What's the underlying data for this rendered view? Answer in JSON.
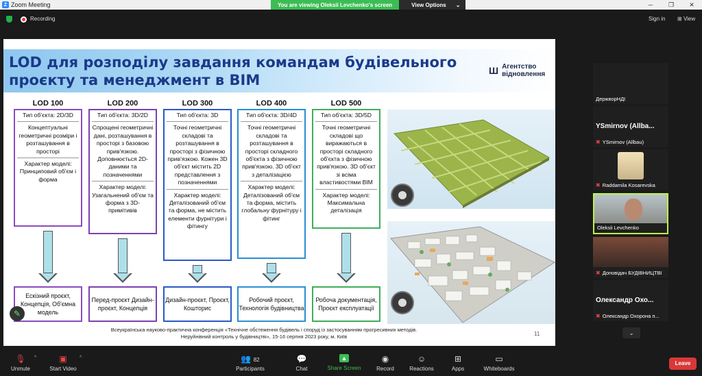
{
  "window": {
    "title": "Zoom Meeting",
    "viewing_banner": "You are viewing Oleksii Levchenko's screen",
    "view_options": "View Options",
    "sign_in": "Sign in",
    "view": "View"
  },
  "topbar": {
    "recording": "Recording"
  },
  "slide": {
    "title_line1": "LOD для розподілу завдання командам будівельного",
    "title_line2": "проєкту та менеджмент в BIM",
    "agency": "Агентство відновлення",
    "columns": [
      {
        "head": "LOD 100",
        "type": "Тип об'єкта: 2D/3D",
        "desc": "Концептуальні геометричні розміри і розташування в просторі",
        "model": "Характер моделі: Принциповий об'єм і форма",
        "bottom": "Ескізний проєкт, Концепція, Об'ємна модель",
        "color": "#8a4bbf"
      },
      {
        "head": "LOD 200",
        "type": "Тип об'єкта: 3D/2D",
        "desc": "Спрощені геометричні дані, розташування в просторі з базовою прив'язкою. Доповнюється 2D-даними та позначеннями",
        "model": "Характер моделі: Узагальнений об'єм та форма з 3D-примітивів",
        "bottom": "Перед-проєкт Дизайн-проєкт, Концепція",
        "color": "#7d3fb0"
      },
      {
        "head": "LOD 300",
        "type": "Тип об'єкта: 3D",
        "desc": "Точні геометричні складові та розташування в просторі з фізичною прив'язкою. Кожен 3D об'єкт містить 2D представлення з позначеннями",
        "model": "Характер моделі: Деталізований об'єм та форма, не містить елементи фурнітури і фітингу",
        "bottom": "Дизайн-проєкт, Проєкт, Кошторис",
        "color": "#2a59c6"
      },
      {
        "head": "LOD 400",
        "type": "Тип об'єкта: 3D/4D",
        "desc": "Точні геометричні складові та розташування в просторі складного об'єкта з фізичною прив'язкою. 3D об'єкт з деталізацією",
        "model": "Характер моделі: Деталізований об'єм та форма, містить глобальну фурнітуру і фітинг",
        "bottom": "Робочий проєкт, Технологія будівництва",
        "color": "#2a8fd0"
      },
      {
        "head": "LOD 500",
        "type": "Тип об'єкта: 3D/5D",
        "desc": "Точні геометричні складові що виражаються в просторі складного об'єкта з фізичною прив'язкою. 3D об'єкт зі всіма властивостями BIM",
        "model": "Характер моделі: Максимальна деталізація",
        "bottom": "Робоча документація, Проєкт експлуатації",
        "color": "#3fae5a"
      }
    ],
    "footer_line1": "Всеукраїнська науково-практична конференція «Технічне обстеження будівель і споруд із застосуванням прогресивних методів.",
    "footer_line2": "Неруйнівний контроль у будівництві», 15-16 серпня 2023 року, м. Київ",
    "page_number": "11"
  },
  "participants": [
    {
      "big": "",
      "label": "ДержворНДІ",
      "muted": false
    },
    {
      "big": "YSmirnov (Allba...",
      "label": "YSmirnov (Allbau)",
      "muted": true
    },
    {
      "big": "",
      "label": "Raddamila Kosarevska",
      "muted": true
    },
    {
      "big": "",
      "label": "Oleksii Levchenko",
      "muted": false,
      "active": true
    },
    {
      "big": "",
      "label": "Доповідач БУДІВНИЦТВІ",
      "muted": true
    },
    {
      "big": "Олександр Охо...",
      "label": "Олександр Охорона п...",
      "muted": true
    }
  ],
  "toolbar": {
    "unmute": "Unmute",
    "start_video": "Start Video",
    "participants": "Participants",
    "participants_count": "82",
    "chat": "Chat",
    "share_screen": "Share Screen",
    "record": "Record",
    "reactions": "Reactions",
    "apps": "Apps",
    "whiteboards": "Whiteboards",
    "leave": "Leave"
  }
}
